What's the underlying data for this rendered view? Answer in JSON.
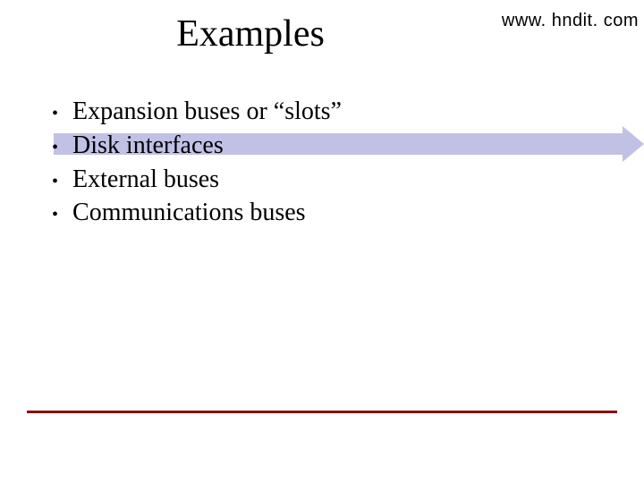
{
  "header": {
    "url": "www. hndit. com"
  },
  "slide": {
    "title": "Examples",
    "bullets": [
      "Expansion buses or “slots”",
      "Disk interfaces",
      "External buses",
      "Communications buses"
    ]
  }
}
